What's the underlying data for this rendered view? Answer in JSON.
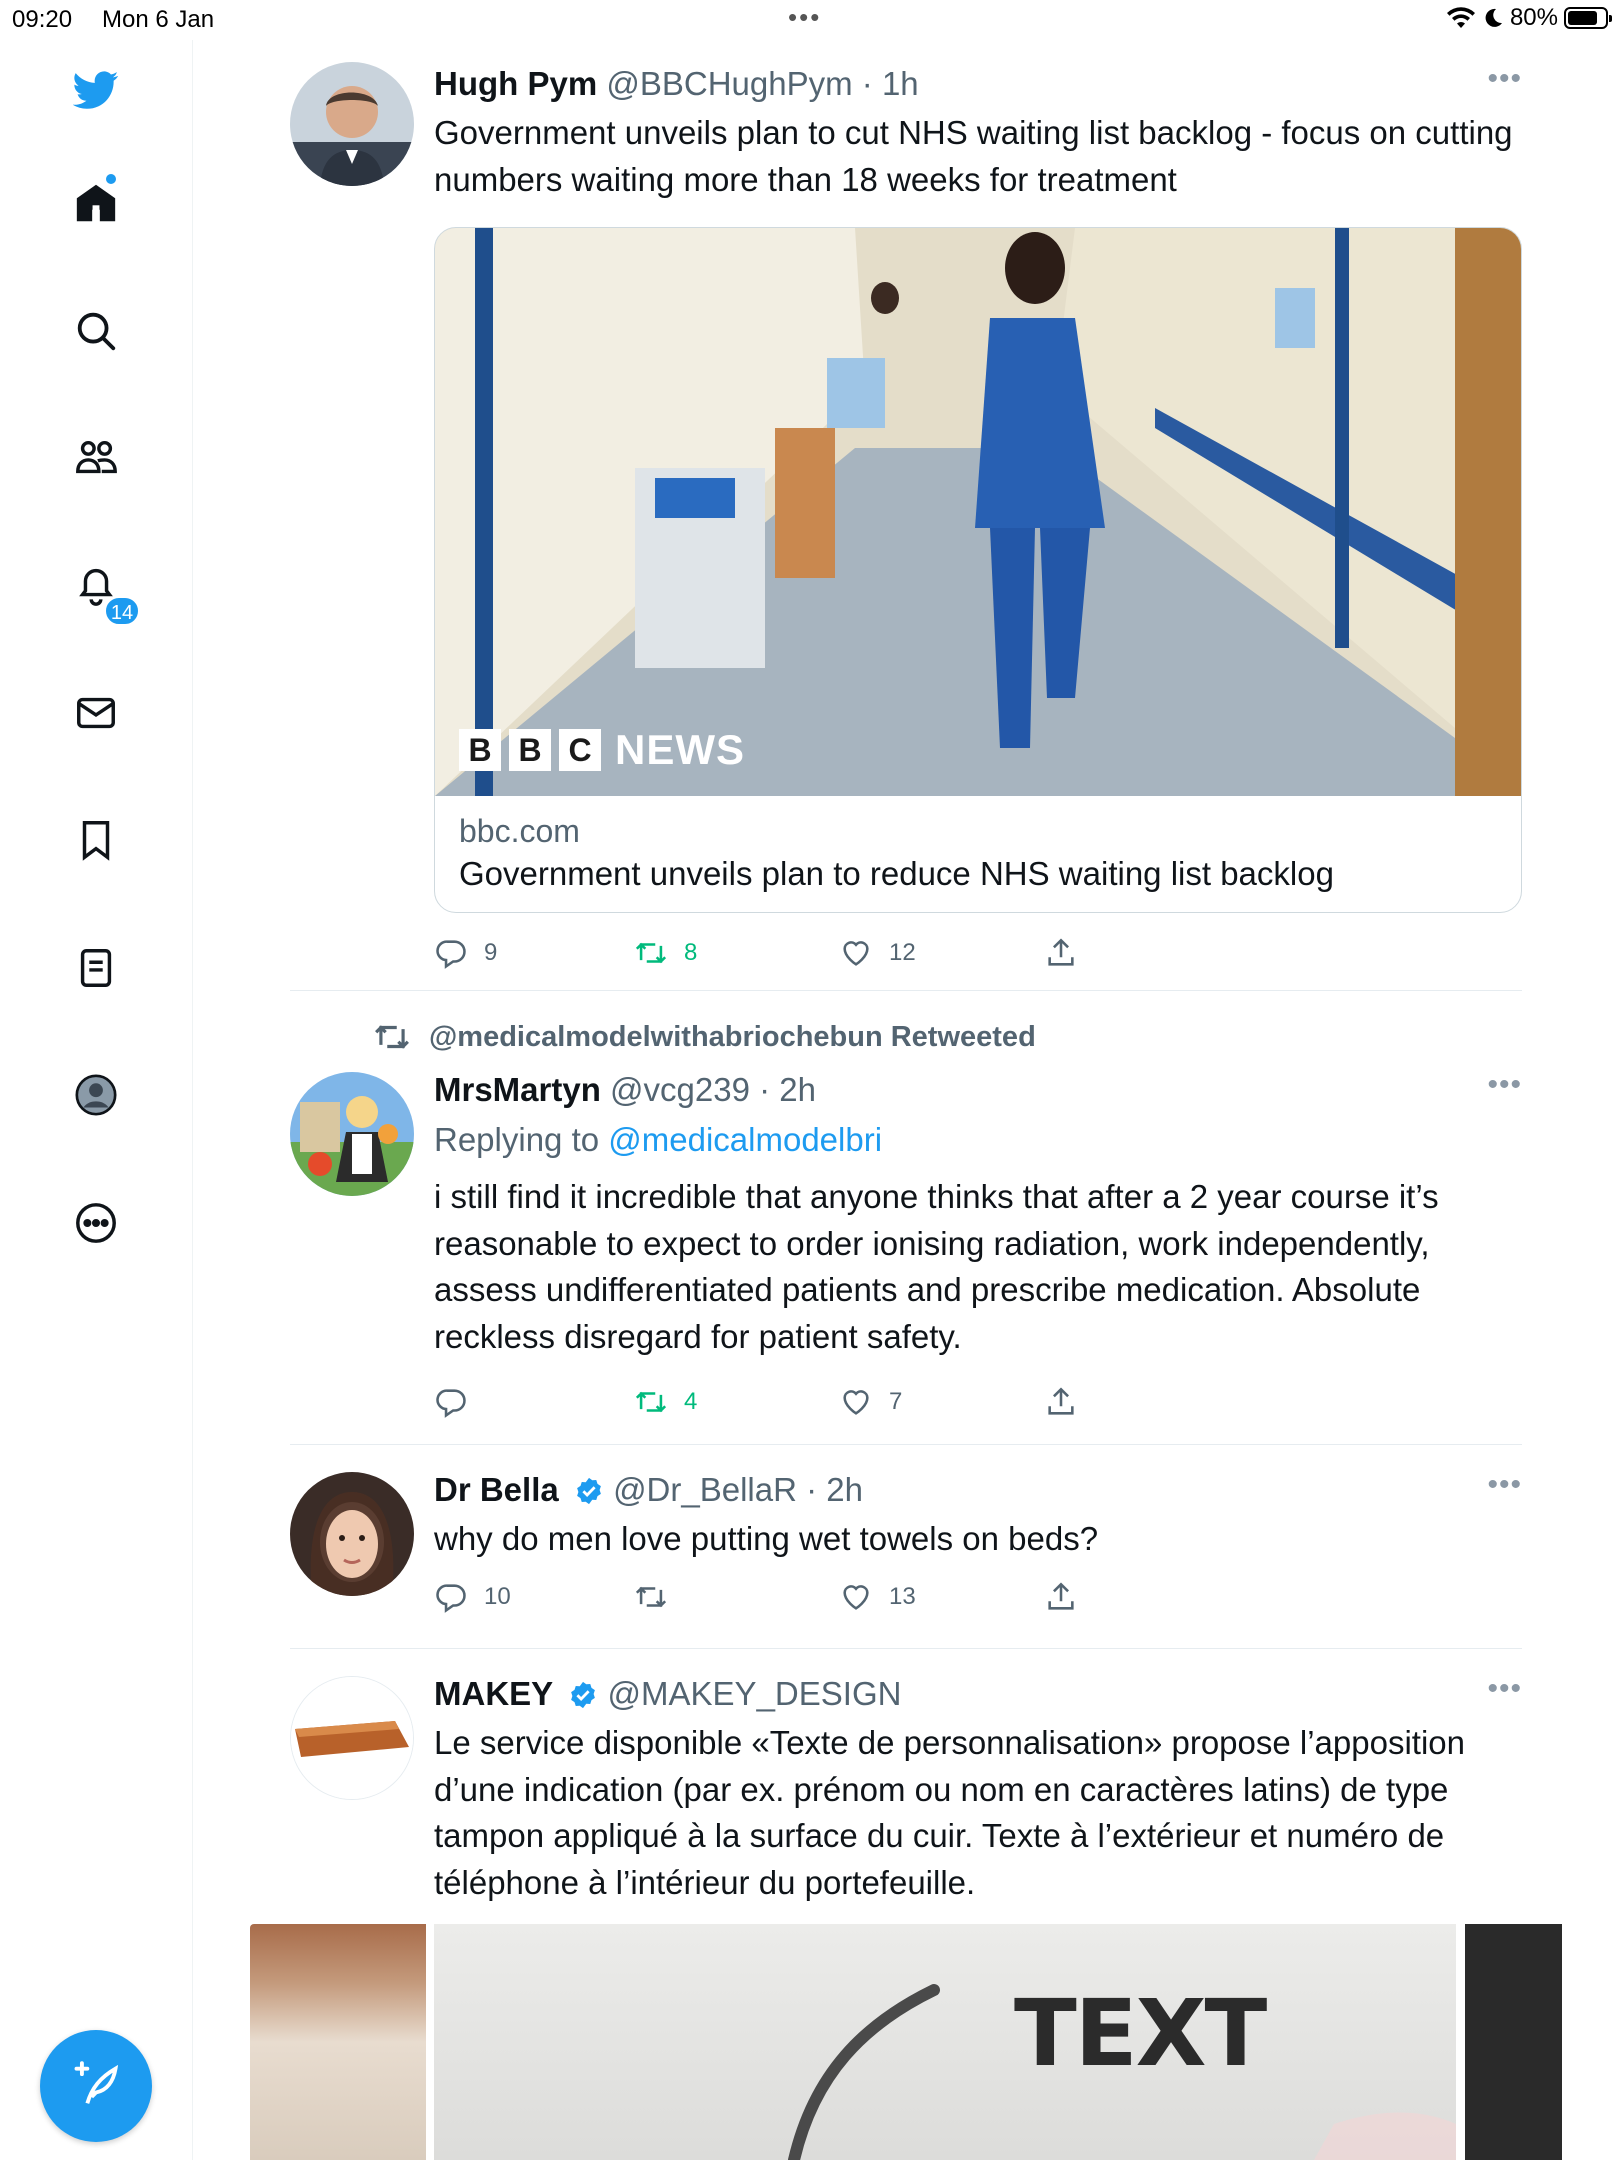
{
  "status_bar": {
    "time": "09:20",
    "date": "Mon 6 Jan",
    "battery": "80%"
  },
  "sidebar": {
    "notifications_badge": "14"
  },
  "tweets": [
    {
      "name": "Hugh Pym",
      "handle": "@BBCHughPym",
      "time": "· 1h",
      "text": "Government unveils plan to cut NHS waiting list backlog - focus on cutting numbers waiting more than 18 weeks for treatment",
      "card": {
        "brand_letters": [
          "B",
          "B",
          "C"
        ],
        "brand_word": "NEWS",
        "domain": "bbc.com",
        "title": "Government unveils plan to reduce NHS waiting list backlog"
      },
      "replies": "9",
      "retweets": "8",
      "likes": "12"
    },
    {
      "retweeted_by": "@medicalmodelwithabriochebun Retweeted",
      "name": "MrsMartyn",
      "handle": "@vcg239",
      "time": "· 2h",
      "replying_prefix": "Replying to ",
      "replying_to": "@medicalmodelbri",
      "text": "i still find it incredible that anyone thinks that after a 2 year course it’s reasonable to expect to order ionising radiation, work independently, assess undifferentiated patients and prescribe medication. Absolute reckless disregard for patient safety.",
      "replies": "",
      "retweets": "4",
      "likes": "7"
    },
    {
      "name": "Dr Bella",
      "handle": "@Dr_BellaR",
      "time": "· 2h",
      "text": "why do men love putting wet towels on beds?",
      "replies": "10",
      "retweets": "",
      "likes": "13"
    },
    {
      "name": "MAKEY",
      "handle": "@MAKEY_DESIGN",
      "time": "",
      "text": "Le service disponible «Texte de personnalisation» propose l’apposition d’une indication (par ex. prénom ou nom en caractères latins) de type tampon appliqué à la surface du cuir. Texte à l’extérieur et numéro de téléphone à l’intérieur du portefeuille.",
      "media_text": "TEXT"
    }
  ],
  "colors": {
    "accent": "#1d9bf0",
    "retweet_green": "#00ba7c",
    "secondary_text": "#536471"
  }
}
